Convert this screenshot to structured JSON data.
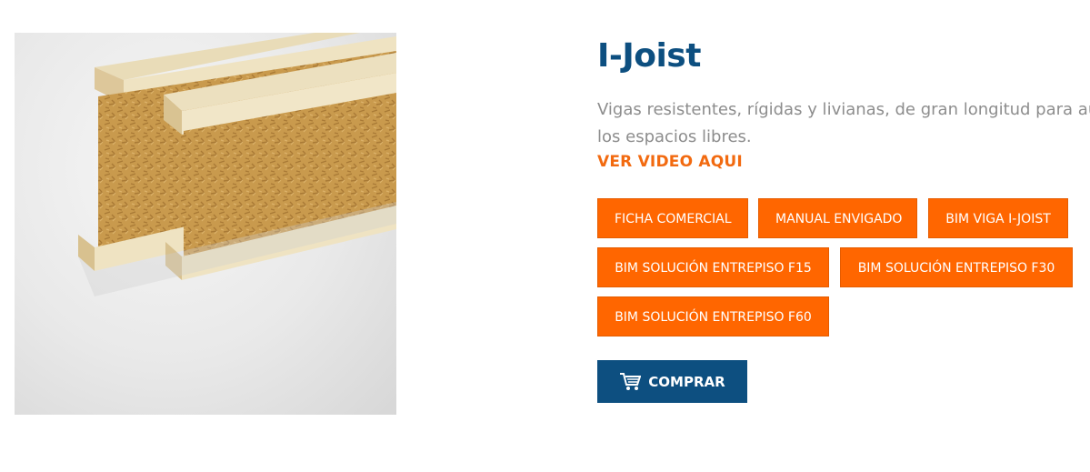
{
  "product": {
    "title": "I-Joist",
    "description_line1": "Vigas resistentes, rígidas y livianas, de gran longitud para aume",
    "description_line2": "los espacios libres.",
    "video_link": "VER VIDEO AQUI"
  },
  "documents": [
    {
      "label": "FICHA COMERCIAL"
    },
    {
      "label": "MANUAL ENVIGADO"
    },
    {
      "label": "BIM VIGA I-JOIST"
    },
    {
      "label": "BIM SOLUCIÓN ENTREPISO F15"
    },
    {
      "label": "BIM SOLUCIÓN ENTREPISO F30"
    },
    {
      "label": "BIM SOLUCIÓN ENTREPISO F60"
    }
  ],
  "buy": {
    "label": "COMPRAR",
    "icon": "shopping-cart-icon"
  },
  "colors": {
    "title": "#0d4f80",
    "accent": "#ff6600",
    "buy": "#0d4f80"
  }
}
